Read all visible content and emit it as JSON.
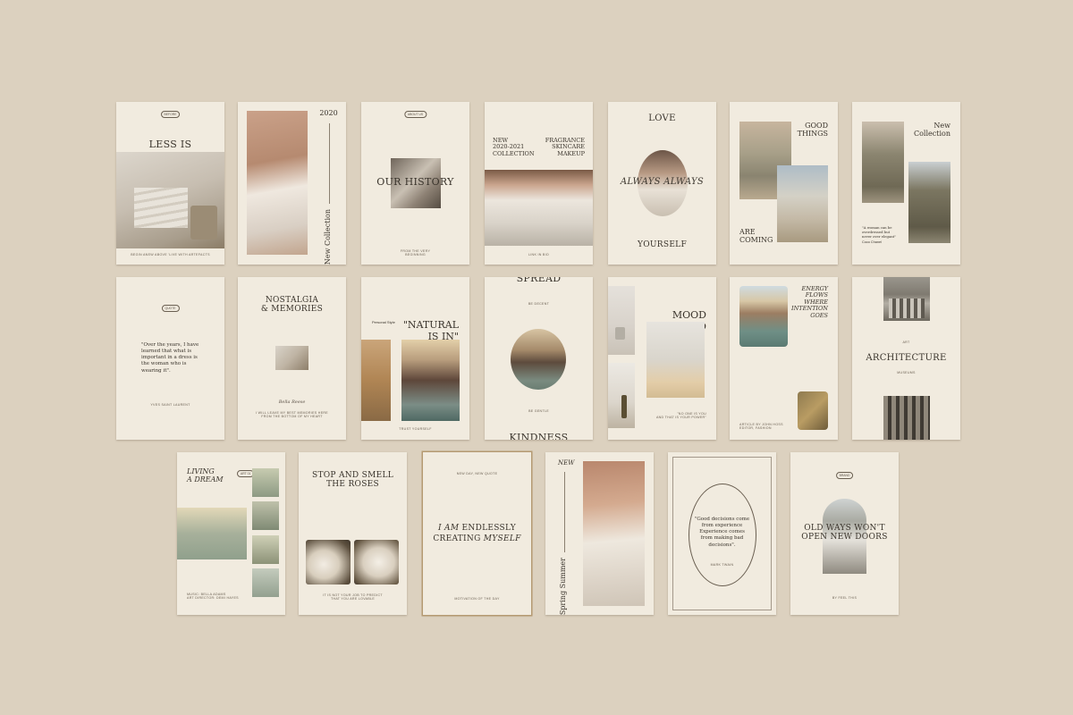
{
  "row1": {
    "c1": {
      "pill": "BEFORE",
      "title": "LESS IS\nMORE",
      "foot": "BEGIN ANEW ABOVE 'LIVE WITH ARTEFACTS"
    },
    "c2": {
      "year": "2020",
      "vertical": "New Collection"
    },
    "c3": {
      "pill": "ABOUT US",
      "title": "OUR HISTORY",
      "foot": "FROM THE VERY\nBEGINNING"
    },
    "c4": {
      "left": "NEW\n2020-2021\nCOLLECTION",
      "right": "FRAGRANCE\nSKINCARE\nMAKEUP",
      "foot": "LINK IN BIO"
    },
    "c5": {
      "top": "LOVE",
      "mid": "ALWAYS ALWAYS",
      "bottom": "YOURSELF"
    },
    "c6": {
      "top": "GOOD\nTHINGS",
      "bottom": "ARE\nCOMING"
    },
    "c7": {
      "title": "New\nCollection",
      "quote": "\"A woman can be\noverdressed but\nnever over elegant\"",
      "author": "Coco Chanel"
    }
  },
  "row2": {
    "c1": {
      "pill": "QUOTE",
      "quote": "\"Over the years, I have\nlearned that what is\nimportant in a dress is\nthe woman who is\nwearing it\".",
      "author": "YVES SAINT LAURENT"
    },
    "c2": {
      "title": "NOSTALGIA\n& MEMORIES",
      "sign": "Bella Reese",
      "foot": "I WILL LEAVE MY BEST MEMORIES HERE\nFROM THE BOTTOM OF MY HEART"
    },
    "c3": {
      "small": "Personal Style",
      "title": "\"NATURAL\nIS IN\"",
      "foot": "TRUST YOURSELF"
    },
    "c4": {
      "top": "SPREAD",
      "sub": "BE DECENT",
      "sub2": "BE GENTLE",
      "bottom": "KINDNESS"
    },
    "c5": {
      "title": "MOOD\nBOARD",
      "foot": "\"NO ONE IS YOU\nAND THAT IS YOUR POWER\""
    },
    "c6": {
      "title": "ENERGY\nFLOWS\nWHERE\nINTENTION\nGOES",
      "foot": "ARTICLE BY JOHN HOSS\nEDITOR, FASHION"
    },
    "c7": {
      "small": "ART",
      "title": "ARCHITECTURE",
      "foot": "MUSEUMS"
    }
  },
  "row3": {
    "c1": {
      "title": "LIVING\nA DREAM",
      "pill": "ART 01",
      "foot": "MUSIC: BELLA ADAMS\nART DIRECTOR: DEMI HAYES"
    },
    "c2": {
      "title": "STOP AND SMELL\nTHE ROSES",
      "foot": "IT IS NOT YOUR JOB TO PREDICT\nTHAT YOU ARE LOVABLE"
    },
    "c3": {
      "top": "NEW DAY, NEW QUOTE",
      "l1a": "I AM ",
      "l1b": "ENDLESSLY",
      "l2a": "CREATING ",
      "l2b": "MYSELF",
      "foot": "MOTIVATION OF THE DAY"
    },
    "c4": {
      "new": "NEW",
      "vertical": "Spring Summer"
    },
    "c5": {
      "quote": "\"Good decisions come\nfrom experience\nExperience comes\nfrom making bad\ndecisions\".",
      "author": "MARK TWAIN"
    },
    "c6": {
      "pill": "BRAND",
      "title": "OLD WAYS WON'T\nOPEN NEW DOORS",
      "foot": "BY FEEL THIS"
    }
  },
  "colors": {
    "background": "#dcd1bf",
    "card": "#f1ebdf",
    "ink": "#3a342c"
  }
}
